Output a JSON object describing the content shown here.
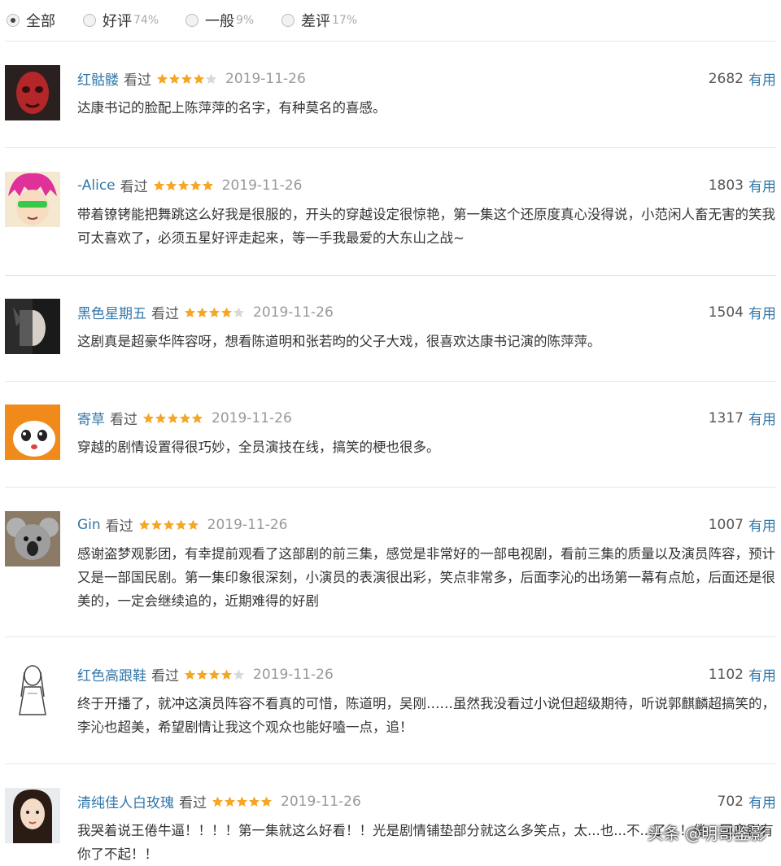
{
  "filters": [
    {
      "label": "全部",
      "pct": "",
      "checked": true
    },
    {
      "label": "好评",
      "pct": "74%",
      "checked": false
    },
    {
      "label": "一般",
      "pct": "9%",
      "checked": false
    },
    {
      "label": "差评",
      "pct": "17%",
      "checked": false
    }
  ],
  "useful_label": "有用",
  "seen_label": "看过",
  "star_colors": {
    "on": "#f5a623",
    "off": "#d8d8d8"
  },
  "reviews": [
    {
      "user": "红骷髅",
      "rating": 4,
      "date": "2019-11-26",
      "votes": "2682",
      "content": "达康书记的脸配上陈萍萍的名字，有种莫名的喜感。"
    },
    {
      "user": "-Alice",
      "rating": 5,
      "date": "2019-11-26",
      "votes": "1803",
      "content": "带着镣铐能把舞跳这么好我是很服的，开头的穿越设定很惊艳，第一集这个还原度真心没得说，小范闲人畜无害的笑我可太喜欢了，必须五星好评走起来，等一手我最爱的大东山之战~"
    },
    {
      "user": "黑色星期五",
      "rating": 4,
      "date": "2019-11-26",
      "votes": "1504",
      "content": "这剧真是超豪华阵容呀，想看陈道明和张若昀的父子大戏，很喜欢达康书记演的陈萍萍。"
    },
    {
      "user": "寄草",
      "rating": 5,
      "date": "2019-11-26",
      "votes": "1317",
      "content": "穿越的剧情设置得很巧妙，全员演技在线，搞笑的梗也很多。"
    },
    {
      "user": "Gin",
      "rating": 5,
      "date": "2019-11-26",
      "votes": "1007",
      "content": "感谢盗梦观影团，有幸提前观看了这部剧的前三集，感觉是非常好的一部电视剧，看前三集的质量以及演员阵容，预计又是一部国民剧。第一集印象很深刻，小演员的表演很出彩，笑点非常多，后面李沁的出场第一幕有点尬，后面还是很美的，一定会继续追的，近期难得的好剧"
    },
    {
      "user": "红色高跟鞋",
      "rating": 4,
      "date": "2019-11-26",
      "votes": "1102",
      "content": "终于开播了，就冲这演员阵容不看真的可惜，陈道明，吴刚……虽然我没看过小说但超级期待，听说郭麒麟超搞笑的，李沁也超美，希望剧情让我这个观众也能好嗑一点，追！"
    },
    {
      "user": "清纯佳人白玫瑰",
      "rating": 5,
      "date": "2019-11-26",
      "votes": "702",
      "content": "我哭着说王倦牛逼！！！！第一集就这么好看！！光是剧情铺垫部分就这么多笑点，太...也...不...了！！倦，国产剧有你了不起！！"
    }
  ],
  "watermark": "头条 @明哥鉴影"
}
